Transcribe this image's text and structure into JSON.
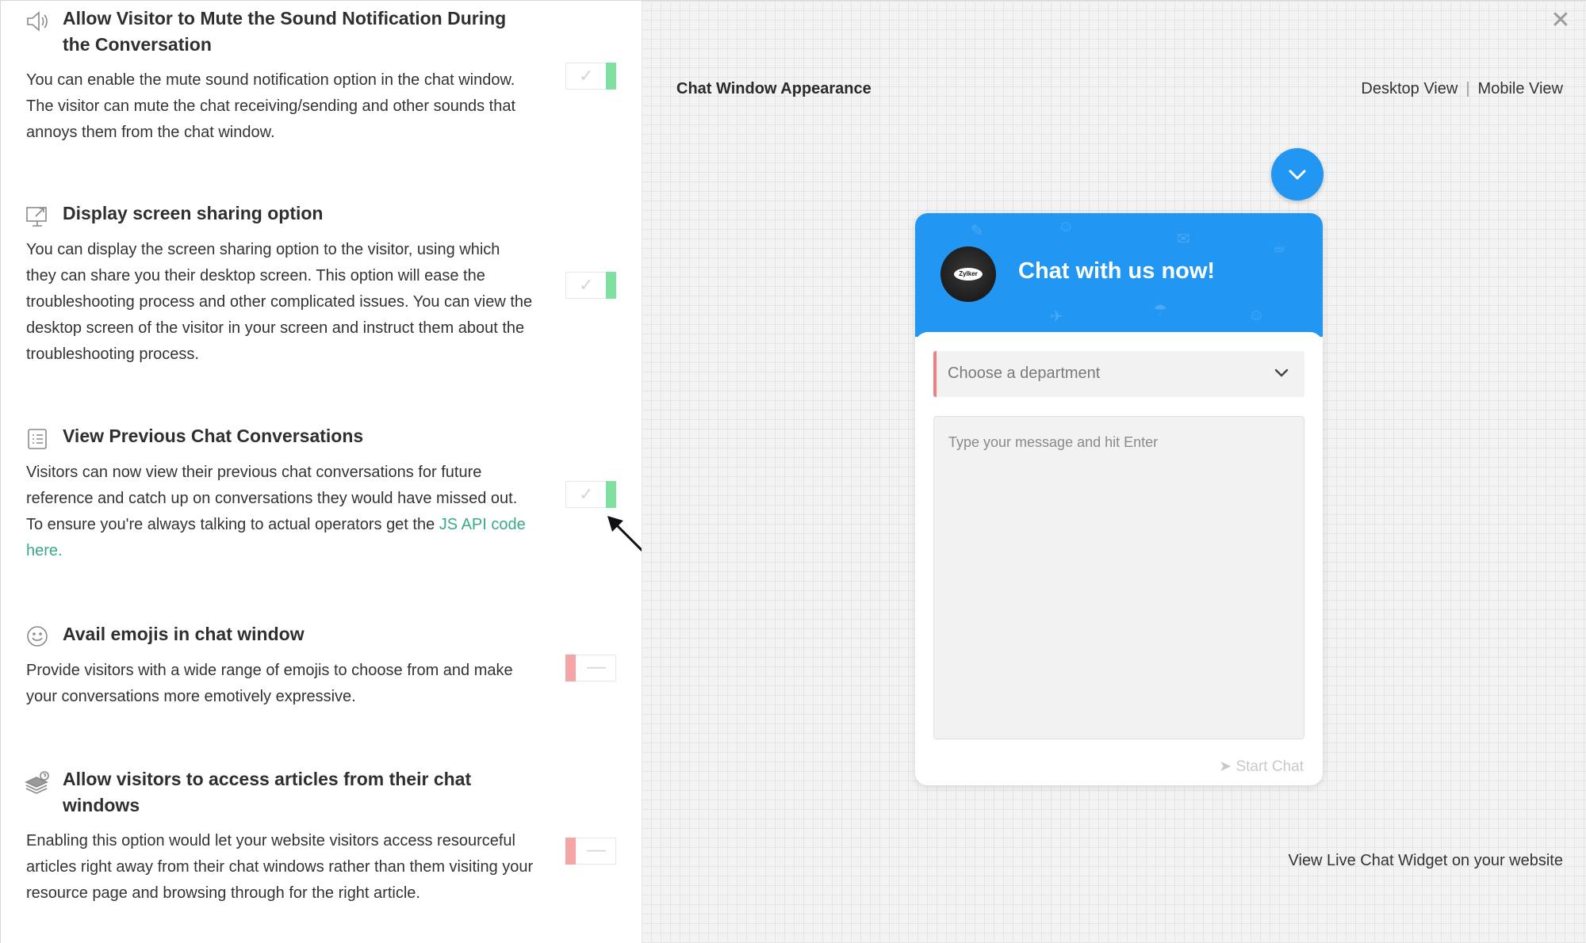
{
  "settings": [
    {
      "icon": "speaker-icon",
      "title": "Allow Visitor to Mute the Sound Notification During the Conversation",
      "description": "You can enable the mute sound notification option in the chat window. The visitor can mute the chat receiving/sending and other sounds that annoys them from the chat window.",
      "enabled": true
    },
    {
      "icon": "screen-share-icon",
      "title": "Display screen sharing option",
      "description": "You can display the screen sharing option to the visitor, using which they can share you their desktop screen. This option will ease the troubleshooting process and other complicated issues. You can view the desktop screen of the visitor in your screen and instruct them about the troubleshooting process.",
      "enabled": true
    },
    {
      "icon": "list-icon",
      "title": "View Previous Chat Conversations",
      "description": "Visitors can now view their previous chat conversations for future reference and catch up on conversations they would have missed out. To ensure you're always talking to actual operators get the",
      "link_text": "JS API code here.",
      "enabled": true
    },
    {
      "icon": "smiley-icon",
      "title": "Avail emojis in chat window",
      "description": "Provide visitors with a wide range of emojis to choose from and make your conversations more emotively expressive.",
      "enabled": false
    },
    {
      "icon": "articles-icon",
      "title": "Allow visitors to access articles from their chat windows",
      "description": "Enabling this option would let your website visitors access resourceful articles right away from their chat windows rather than them visiting your resource page and browsing through for the right article.",
      "enabled": false
    }
  ],
  "preview": {
    "title": "Chat Window Appearance",
    "desktop_view": "Desktop View",
    "separator": "|",
    "mobile_view": "Mobile View",
    "chat_title": "Chat with us now!",
    "brand_logo_text": "Zylker",
    "department_placeholder": "Choose a department",
    "message_placeholder": "Type your message and hit Enter",
    "start_chat": "Start Chat",
    "view_live": "View Live Chat Widget on your website",
    "close_glyph": "✕"
  },
  "colors": {
    "accent_blue": "#2196f3",
    "toggle_on": "#7fe0a0",
    "toggle_off": "#f4a6a6",
    "link": "#3aa88a"
  }
}
